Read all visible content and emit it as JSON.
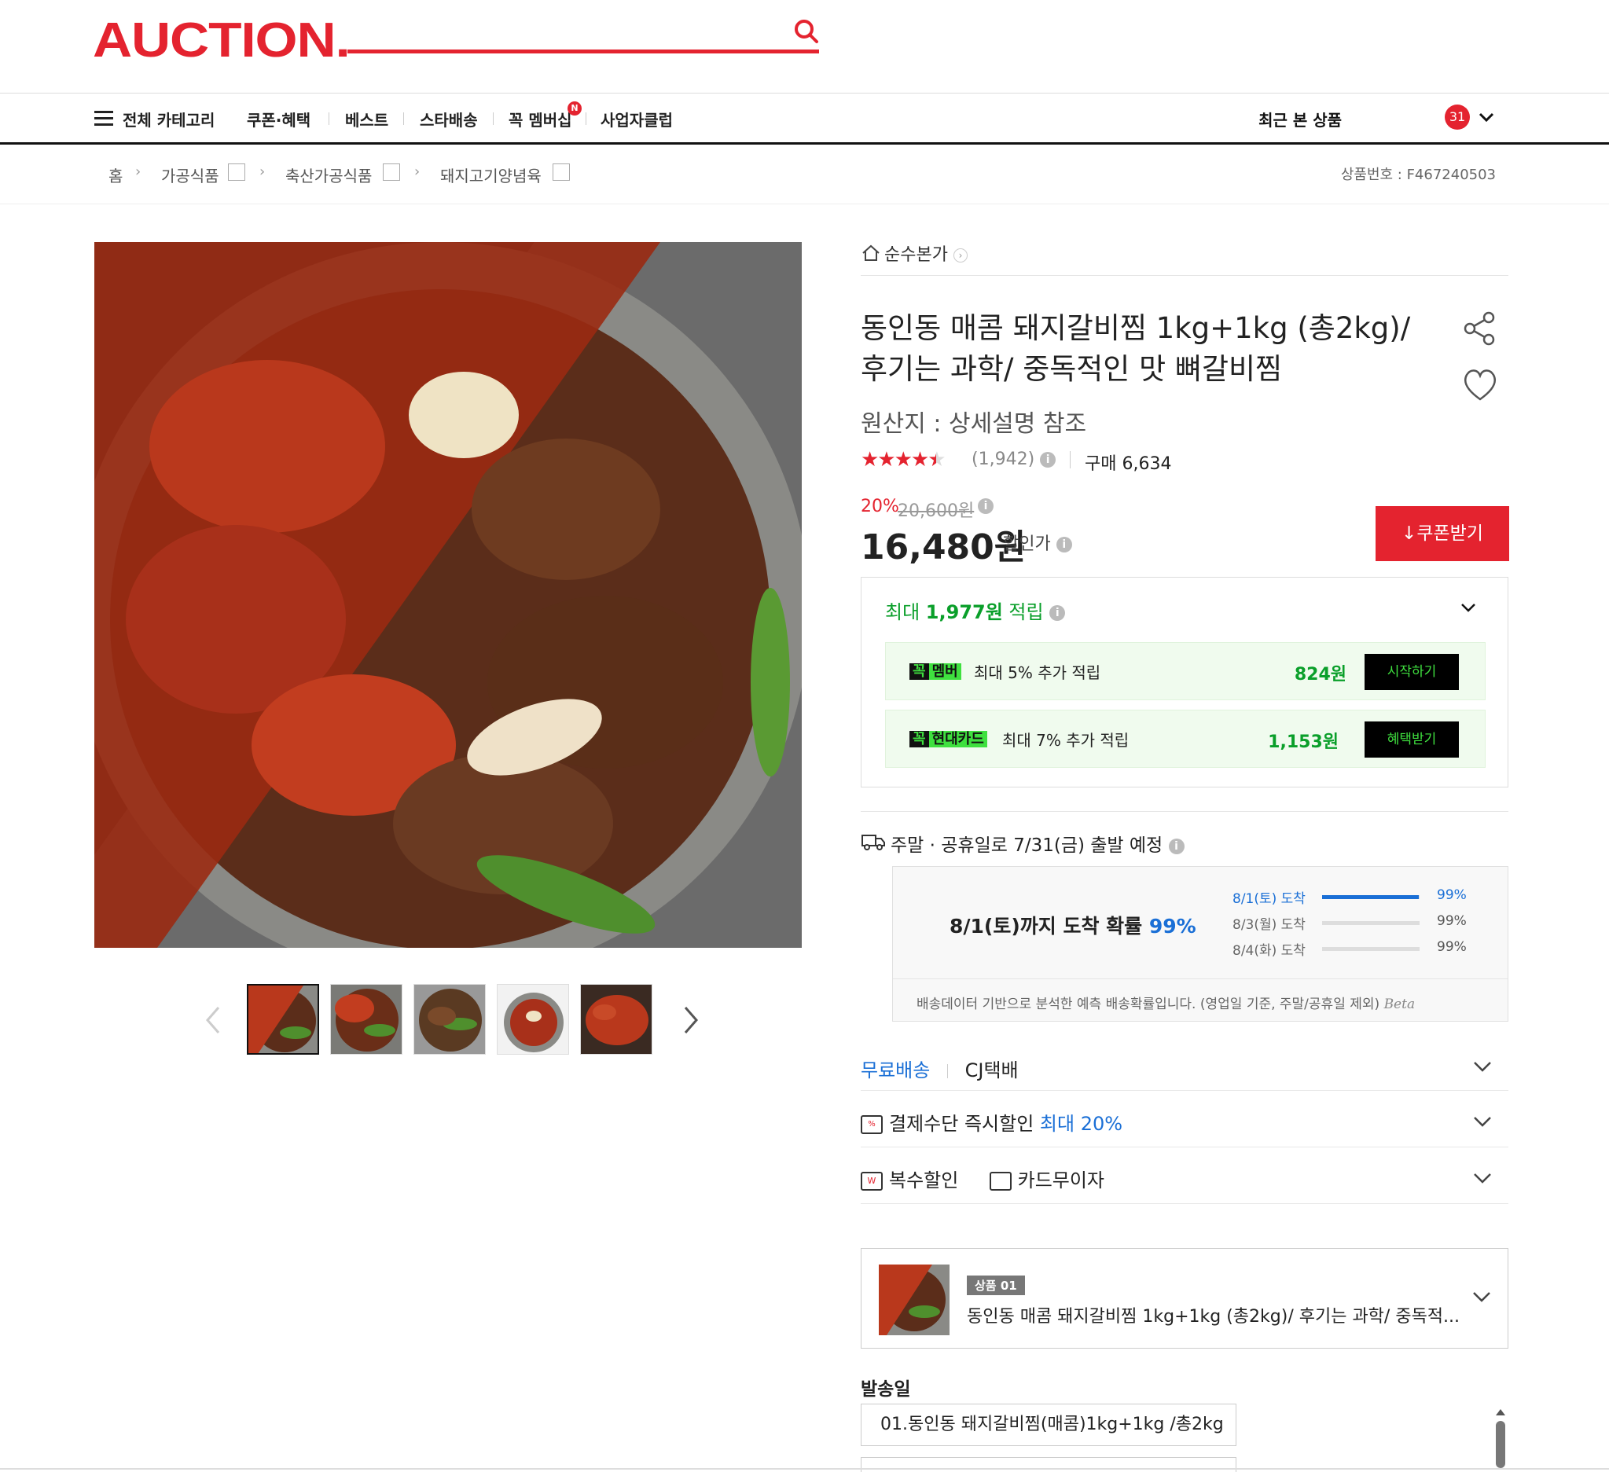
{
  "header": {
    "logo": "AUCTION.",
    "search_placeholder": ""
  },
  "gnb": {
    "all_categories": "전체 카테고리",
    "items": [
      "쿠폰·혜택",
      "베스트",
      "스타배송",
      "꼭 멤버십",
      "사업자클럽"
    ],
    "new_badge": "N",
    "recent_label": "최근 본 상품",
    "recent_count": "31"
  },
  "breadcrumb": {
    "home": "홈",
    "levels": [
      "가공식품",
      "축산가공식품",
      "돼지고기양념육"
    ],
    "item_no": "상품번호 : F467240503"
  },
  "product": {
    "shop": "순수본가",
    "title_line1": "동인동 매콤 돼지갈비찜 1kg+1kg (총2kg)/",
    "title_line2": "후기는 과학/ 중독적인 맛 뼈갈비찜",
    "origin": "원산지 : 상세설명 참조",
    "rating": 4.5,
    "review_count": "(1,942)",
    "purchase": "구매 6,634",
    "discount_rate": "20%",
    "original_price": "20,600원",
    "sale_price": "16,480원",
    "sale_label": "할인가",
    "coupon_button": "쿠폰받기"
  },
  "reward": {
    "head_prefix": "최대 ",
    "head_amount": "1,977원",
    "head_suffix": " 적립",
    "rows": [
      {
        "tag1": "꼭",
        "tag2": "멤버",
        "text": "최대 5% 추가 적립",
        "amount": "824원",
        "button": "시작하기"
      },
      {
        "tag1": "꼭",
        "tag2": "현대카드",
        "text": "최대 7% 추가 적립",
        "amount": "1,153원",
        "button": "혜택받기"
      }
    ]
  },
  "shipping": {
    "head": "주말 · 공휴일로 7/31(금) 출발 예정",
    "prob_prefix": "8/1(토)까지 도착 확률 ",
    "prob_value": "99%",
    "rows": [
      {
        "label": "8/1(토) 도착",
        "pct": "99%",
        "fill": 0.99
      },
      {
        "label": "8/3(월) 도착",
        "pct": "99%",
        "fill": 0
      },
      {
        "label": "8/4(화) 도착",
        "pct": "99%",
        "fill": 0
      }
    ],
    "note": "배송데이터 기반으로 분석한 예측 배송확률입니다. (영업일 기준, 주말/공휴일 제외)",
    "beta": "Beta"
  },
  "options": {
    "free_ship": "무료배송",
    "carrier": "CJ택배",
    "pay_discount": "결제수단 즉시할인 ",
    "pay_discount_hl": "최대 20%",
    "multi_discount": "복수할인",
    "card_installment": "카드무이자"
  },
  "selected": {
    "badge": "상품 01",
    "name": "동인동 매콤 돼지갈비찜 1kg+1kg (총2kg)/ 후기는 과학/ 중독적..."
  },
  "ship_date": {
    "label": "발송일",
    "value": "01.동인동 돼지갈비찜(매콤)1kg+1kg /총2kg"
  }
}
